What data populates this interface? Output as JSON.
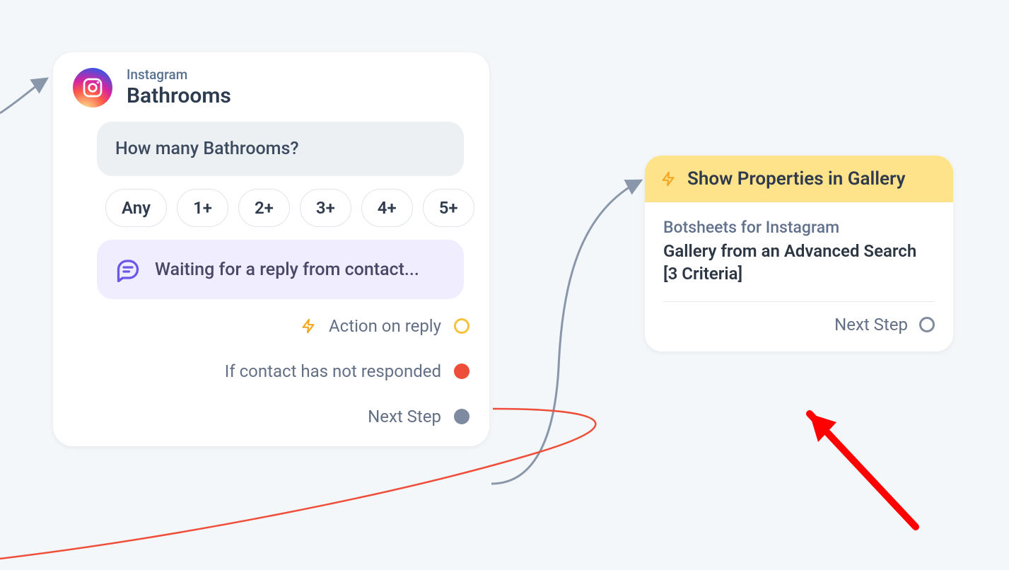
{
  "leftCard": {
    "platform": "Instagram",
    "title": "Bathrooms",
    "message": "How many Bathrooms?",
    "options": [
      "Any",
      "1+",
      "2+",
      "3+",
      "4+",
      "5+"
    ],
    "waitingText": "Waiting for a reply from contact...",
    "connectors": {
      "actionOnReply": "Action on reply",
      "notResponded": "If contact has not responded",
      "nextStep": "Next Step"
    }
  },
  "rightCard": {
    "headerTitle": "Show Properties in Gallery",
    "subTitle": "Botsheets for Instagram",
    "description": "Gallery from an Advanced Search [3 Criteria]",
    "nextStep": "Next Step"
  }
}
